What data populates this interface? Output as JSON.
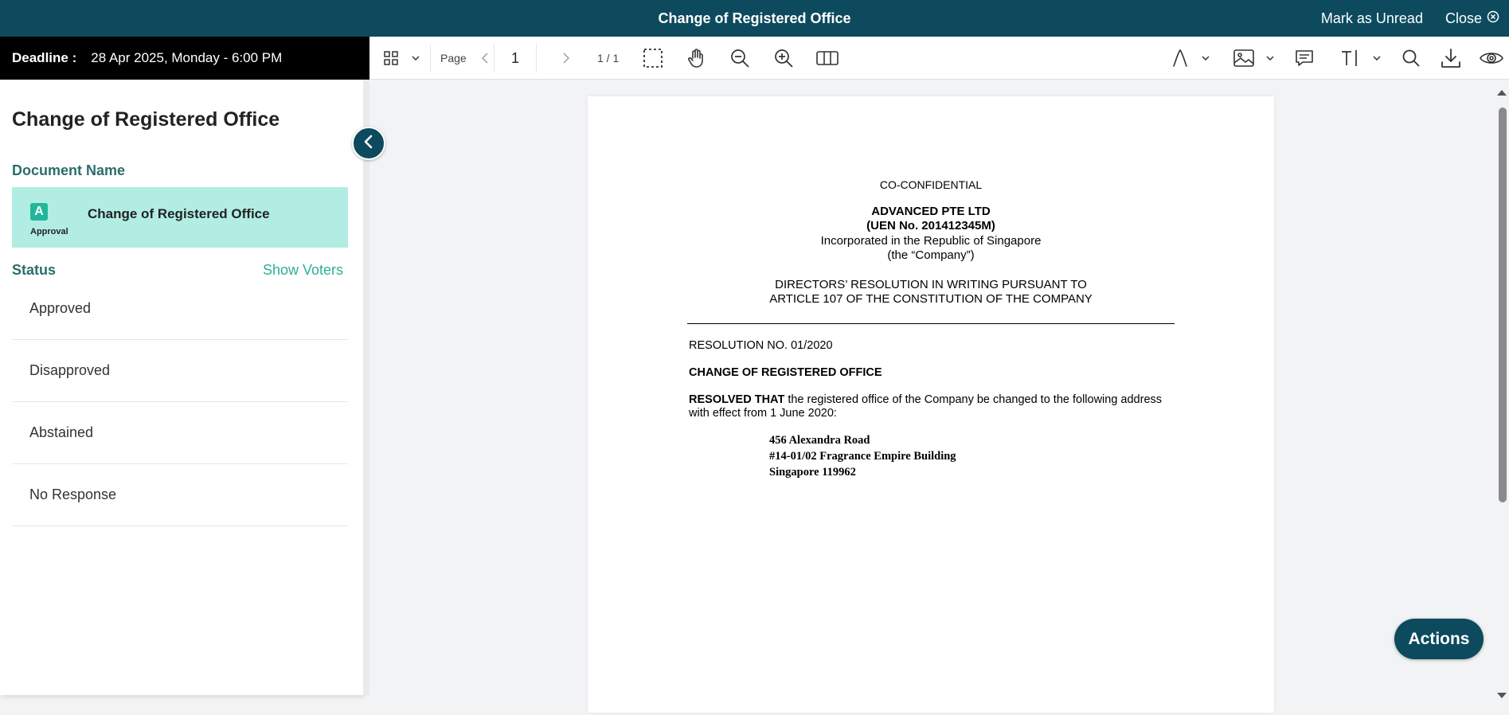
{
  "window": {
    "title": "Change of Registered Office",
    "mark_unread": "Mark as Unread",
    "close": "Close"
  },
  "deadline": {
    "label": "Deadline :",
    "value": "28 Apr 2025, Monday - 6:00 PM"
  },
  "toolbar": {
    "page_label": "Page",
    "page_value": "1",
    "page_count": "1 / 1",
    "icons": [
      "grid-view-icon",
      "chevron-down-icon",
      "prev-page-icon",
      "next-page-icon",
      "marquee-select-icon",
      "pan-hand-icon",
      "zoom-out-icon",
      "zoom-in-icon",
      "two-page-view-icon",
      "signature-pen-icon",
      "image-icon",
      "comment-icon",
      "text-cursor-icon",
      "search-icon",
      "download-icon",
      "eye-icon"
    ]
  },
  "sidebar": {
    "title": "Change of Registered Office",
    "document_section": "Document Name",
    "document": {
      "badge_letter": "A",
      "badge_label": "Approval",
      "name": "Change of Registered Office"
    },
    "status_section": "Status",
    "show_voters": "Show Voters",
    "statuses": [
      "Approved",
      "Disapproved",
      "Abstained",
      "No Response"
    ]
  },
  "document": {
    "confidential": "CO-CONFIDENTIAL",
    "company": "ADVANCED PTE LTD",
    "uen": "(UEN No. 201412345M)",
    "incorporated": "Incorporated in the Republic of Singapore",
    "company_alias": "(the “Company”)",
    "heading_line1": "DIRECTORS’ RESOLUTION IN WRITING PURSUANT TO",
    "heading_line2": "ARTICLE 107 OF THE CONSTITUTION OF THE COMPANY",
    "resolution_no": "RESOLUTION NO. 01/2020",
    "resolution_title": "CHANGE OF REGISTERED OFFICE",
    "resolved_that": "RESOLVED THAT",
    "resolved_text_1": " the registered office of the Company be changed to the following address",
    "resolved_text_2": "with effect from 1 June 2020:",
    "address_line1": "456 Alexandra Road",
    "address_line2": "#14-01/02 Fragrance Empire Building",
    "address_line3": "Singapore 119962"
  },
  "actions_label": "Actions",
  "colors": {
    "header": "#0d4a5e",
    "accent_teal": "#2bb19a",
    "doc_card_bg": "#b2ede3",
    "section_heading": "#2b6e6b"
  }
}
